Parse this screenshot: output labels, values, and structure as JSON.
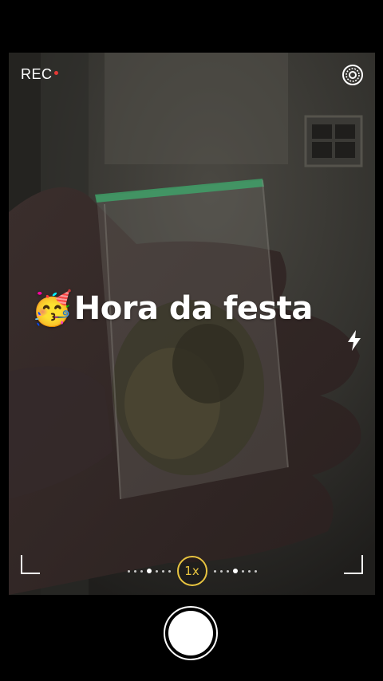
{
  "status": {
    "rec_label": "REC",
    "rec_dot_color": "#e53935"
  },
  "caption": {
    "emoji": "🥳",
    "text": "Hora da festa"
  },
  "icons": {
    "settings": "settings-ring-icon",
    "flash": "flash-icon",
    "shutter": "shutter-button"
  },
  "zoom": {
    "label": "1x",
    "accent_color": "#e8c440"
  }
}
